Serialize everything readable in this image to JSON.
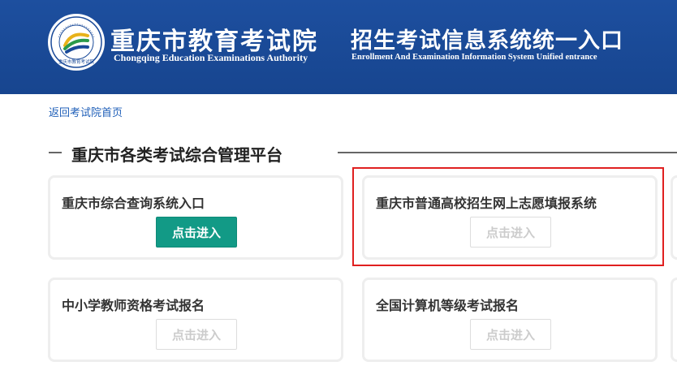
{
  "header": {
    "title_cn": "重庆市教育考试院",
    "title_en": "Chongqing Education Examinations Authority",
    "subtitle_cn": "招生考试信息系统统一入口",
    "subtitle_en": "Enrollment And Examination Information System Unified entrance",
    "logo_ring_text": "Chongqing Education Examination Authority",
    "logo_bottom_text": "重庆市教育考试院",
    "colors": {
      "background": "#1a4a99",
      "text": "#ffffff"
    }
  },
  "nav": {
    "back_link": "返回考试院首页"
  },
  "section": {
    "title": "重庆市各类考试综合管理平台"
  },
  "cards": [
    {
      "title": "重庆市综合查询系统入口",
      "button": "点击进入",
      "enabled": true
    },
    {
      "title": "重庆市普通高校招生网上志愿填报系统",
      "button": "点击进入",
      "enabled": false,
      "highlighted": true
    },
    {
      "title": "中小学教师资格考试报名",
      "button": "点击进入",
      "enabled": false
    },
    {
      "title": "全国计算机等级考试报名",
      "button": "点击进入",
      "enabled": false
    }
  ],
  "colors": {
    "accent_button": "#129a86",
    "highlight_border": "#e02020",
    "link": "#1f5fb8"
  }
}
